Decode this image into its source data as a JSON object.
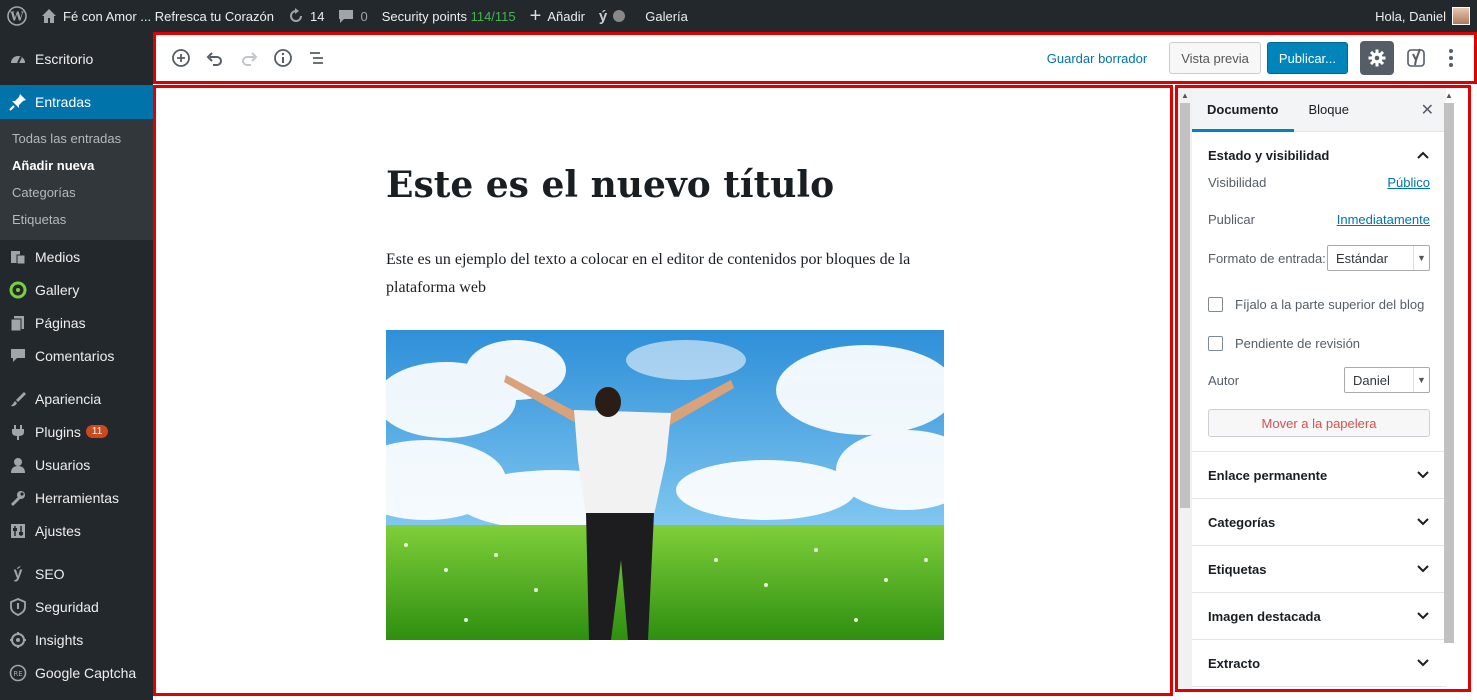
{
  "adminbar": {
    "site_name": "Fé con Amor ... Refresca tu Corazón",
    "updates_count": "14",
    "comments_count": "0",
    "security_label": "Security points",
    "security_value": "114/115",
    "add_new": "Añadir",
    "gallery": "Galería",
    "greeting": "Hola, Daniel"
  },
  "menu": {
    "items": [
      {
        "label": "Escritorio",
        "icon": "dashboard-icon"
      },
      {
        "label": "Entradas",
        "icon": "pin-icon"
      },
      {
        "label": "Medios",
        "icon": "media-icon"
      },
      {
        "label": "Gallery",
        "icon": "gallery-icon"
      },
      {
        "label": "Páginas",
        "icon": "pages-icon"
      },
      {
        "label": "Comentarios",
        "icon": "comments-icon"
      },
      {
        "label": "Apariencia",
        "icon": "brush-icon"
      },
      {
        "label": "Plugins",
        "icon": "plugin-icon",
        "badge": "11"
      },
      {
        "label": "Usuarios",
        "icon": "user-icon"
      },
      {
        "label": "Herramientas",
        "icon": "wrench-icon"
      },
      {
        "label": "Ajustes",
        "icon": "settings-sliders-icon"
      },
      {
        "label": "SEO",
        "icon": "yoast-icon"
      },
      {
        "label": "Seguridad",
        "icon": "shield-icon"
      },
      {
        "label": "Insights",
        "icon": "insights-icon"
      },
      {
        "label": "Google Captcha",
        "icon": "captcha-icon"
      }
    ],
    "submenu": [
      "Todas las entradas",
      "Añadir nueva",
      "Categorías",
      "Etiquetas"
    ]
  },
  "toolbar": {
    "save_draft": "Guardar borrador",
    "preview": "Vista previa",
    "publish": "Publicar..."
  },
  "post": {
    "title": "Este es el nuevo título",
    "paragraph": "Este es un ejemplo del texto a colocar en el editor de contenidos por bloques de la plataforma web"
  },
  "sidebar": {
    "tab_document": "Documento",
    "tab_block": "Bloque",
    "status_panel_title": "Estado y visibilidad",
    "visibility_label": "Visibilidad",
    "visibility_value": "Público",
    "publish_label": "Publicar",
    "publish_value": "Inmediatamente",
    "format_label": "Formato de entrada:",
    "format_value": "Estándar",
    "sticky_label": "Fíjalo a la parte superior del blog",
    "pending_label": "Pendiente de revisión",
    "author_label": "Autor",
    "author_value": "Daniel",
    "trash_label": "Mover a la papelera",
    "panels": [
      "Enlace permanente",
      "Categorías",
      "Etiquetas",
      "Imagen destacada",
      "Extracto"
    ]
  },
  "colors": {
    "admin_bg": "#23282d",
    "accent": "#0073aa",
    "highlight_border": "#e00000"
  }
}
